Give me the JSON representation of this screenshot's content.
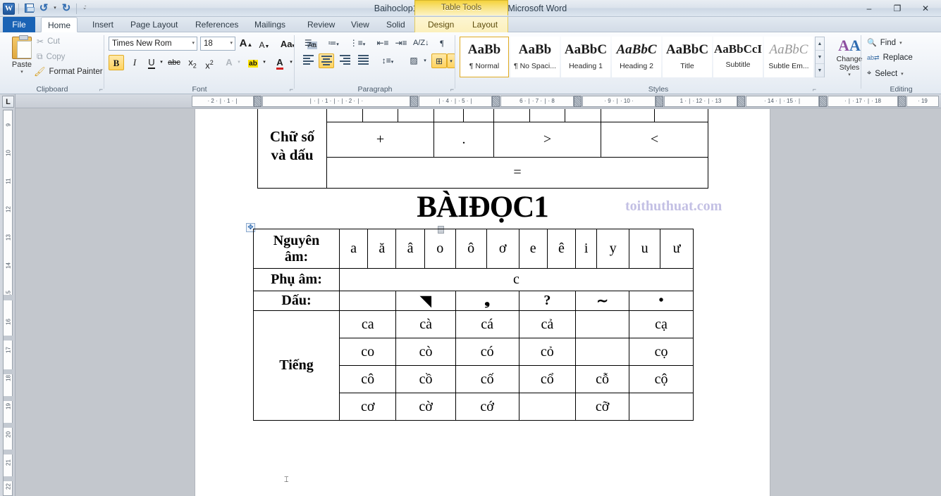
{
  "window": {
    "title": "Baihoclop1 [Compatibility Mode]  -  Microsoft Word",
    "app_logo": "word-logo",
    "minimize": "–",
    "restore": "❐",
    "close": "✕"
  },
  "quick_access": {
    "save": "save-icon",
    "undo": "undo-icon",
    "undo_dropdown": "▾",
    "redo": "redo-icon",
    "customize": "▾"
  },
  "contextual": {
    "label": "Table Tools"
  },
  "tabs": [
    {
      "label": "File",
      "kind": "file"
    },
    {
      "label": "Home",
      "kind": "active"
    },
    {
      "label": "Insert",
      "kind": "normal"
    },
    {
      "label": "Page Layout",
      "kind": "normal"
    },
    {
      "label": "References",
      "kind": "normal"
    },
    {
      "label": "Mailings",
      "kind": "normal"
    },
    {
      "label": "Review",
      "kind": "normal"
    },
    {
      "label": "View",
      "kind": "normal"
    },
    {
      "label": "Solid",
      "kind": "normal"
    },
    {
      "label": "Design",
      "kind": "ctx"
    },
    {
      "label": "Layout",
      "kind": "ctx"
    }
  ],
  "ribbon": {
    "clipboard": {
      "label": "Clipboard",
      "paste": "Paste",
      "paste_dropdown": "▾",
      "cut": "Cut",
      "copy": "Copy",
      "format_painter": "Format Painter",
      "dialog_launcher": "⌐"
    },
    "font": {
      "label": "Font",
      "font_name": "Times New Rom",
      "font_size": "18",
      "grow_font": "A",
      "shrink_font": "A",
      "change_case": "Aa",
      "clear_formatting": "clear-formatting-icon",
      "bold": "B",
      "italic": "I",
      "underline": "U",
      "strikethrough": "abc",
      "subscript": "x",
      "superscript": "x",
      "text_effects": "A",
      "highlight": "ab",
      "font_color": "A",
      "dialog_launcher": "⌐"
    },
    "paragraph": {
      "label": "Paragraph",
      "bullets": "bullets-icon",
      "numbering": "numbering-icon",
      "multilevel": "multilevel-list-icon",
      "decrease_indent": "decrease-indent-icon",
      "increase_indent": "increase-indent-icon",
      "sort": "sort-icon",
      "show_marks": "¶",
      "align_left": "align-left-icon",
      "align_center": "align-center-icon",
      "align_right": "align-right-icon",
      "justify": "justify-icon",
      "line_spacing": "line-spacing-icon",
      "shading": "shading-icon",
      "borders": "borders-icon",
      "dialog_launcher": "⌐"
    },
    "styles": {
      "label": "Styles",
      "items": [
        {
          "preview": "AaBb",
          "name": "¶ Normal",
          "selected": true
        },
        {
          "preview": "AaBb",
          "name": "¶ No Spaci...",
          "selected": false
        },
        {
          "preview": "AaBbC",
          "name": "Heading 1",
          "selected": false
        },
        {
          "preview": "AaBbC",
          "name": "Heading 2",
          "selected": false
        },
        {
          "preview": "AaBbC",
          "name": "Title",
          "selected": false
        },
        {
          "preview": "AaBbCcI",
          "name": "Subtitle",
          "selected": false
        },
        {
          "preview": "AaBbC",
          "name": "Subtle Em...",
          "selected": false
        }
      ],
      "scroll_up": "▲",
      "scroll_down": "▼",
      "more": "▼",
      "change_styles": "Change Styles",
      "change_styles_dropdown": "▾",
      "dialog_launcher": "⌐"
    },
    "editing": {
      "label": "Editing",
      "find": "Find",
      "find_dropdown": "▾",
      "replace": "Replace",
      "select": "Select",
      "select_dropdown": "▾"
    }
  },
  "rulers": {
    "tab_selector": "L",
    "horizontal_segments": [
      "·  2  ·  ∣  ·  1  ·  ∣",
      "∣  ·  ∣  ·  1  ·  ∣  ·  ∣  ·  2  ·  ∣  ·",
      "∣  ·  4  ·  ∣  ·  5  ·  ∣",
      "6  ·  ∣  ·  7  ·  ∣  ·  8",
      "·  9  ·  ∣  ·  10  ·",
      "1  ·  ∣  ·  12  ·  ∣  ·  13",
      "·  14  ·  ∣  ·  15  ·  ∣",
      "·  ∣  ·  17  ·  ∣  ·  18",
      "·  19"
    ],
    "vertical_numbers": [
      "9",
      "10",
      "11",
      "12",
      "13",
      "14",
      "15",
      "16",
      "17",
      "18",
      "19",
      "20",
      "21",
      "22"
    ]
  },
  "document": {
    "title": "BÀIĐỌC1",
    "watermark": "toithuthuat.com",
    "table_move_handle": "move-table-icon",
    "top_table": {
      "row_label": [
        "Chữ số",
        "và dấu"
      ],
      "symbols": [
        "+",
        ".",
        ">",
        "<"
      ],
      "equals": "="
    },
    "main_table": {
      "vowel_label": [
        "Nguyên",
        "âm:"
      ],
      "vowels": [
        "a",
        "ă",
        "â",
        "o",
        "ô",
        "ơ",
        "e",
        "ê",
        "i",
        "y",
        "u",
        "ư"
      ],
      "consonant_label": "Phụ âm:",
      "consonants": "c",
      "tone_label": "Dấu:",
      "tones": [
        "",
        "◥",
        "❟",
        "?",
        "∼",
        "•"
      ],
      "syllable_label": "Tiếng",
      "syllables": [
        [
          "ca",
          "cà",
          "cá",
          "cả",
          "",
          "cạ"
        ],
        [
          "co",
          "cò",
          "có",
          "cỏ",
          "",
          "cọ"
        ],
        [
          "cô",
          "cồ",
          "cố",
          "cổ",
          "cỗ",
          "cộ"
        ],
        [
          "cơ",
          "cờ",
          "cớ",
          "",
          "cỡ",
          ""
        ]
      ]
    }
  },
  "colors": {
    "accent": "#1a63b5",
    "contextual_tab": "#f5d33c",
    "selection_highlight": "#ffd25f",
    "watermark": "#c3c0e4"
  }
}
